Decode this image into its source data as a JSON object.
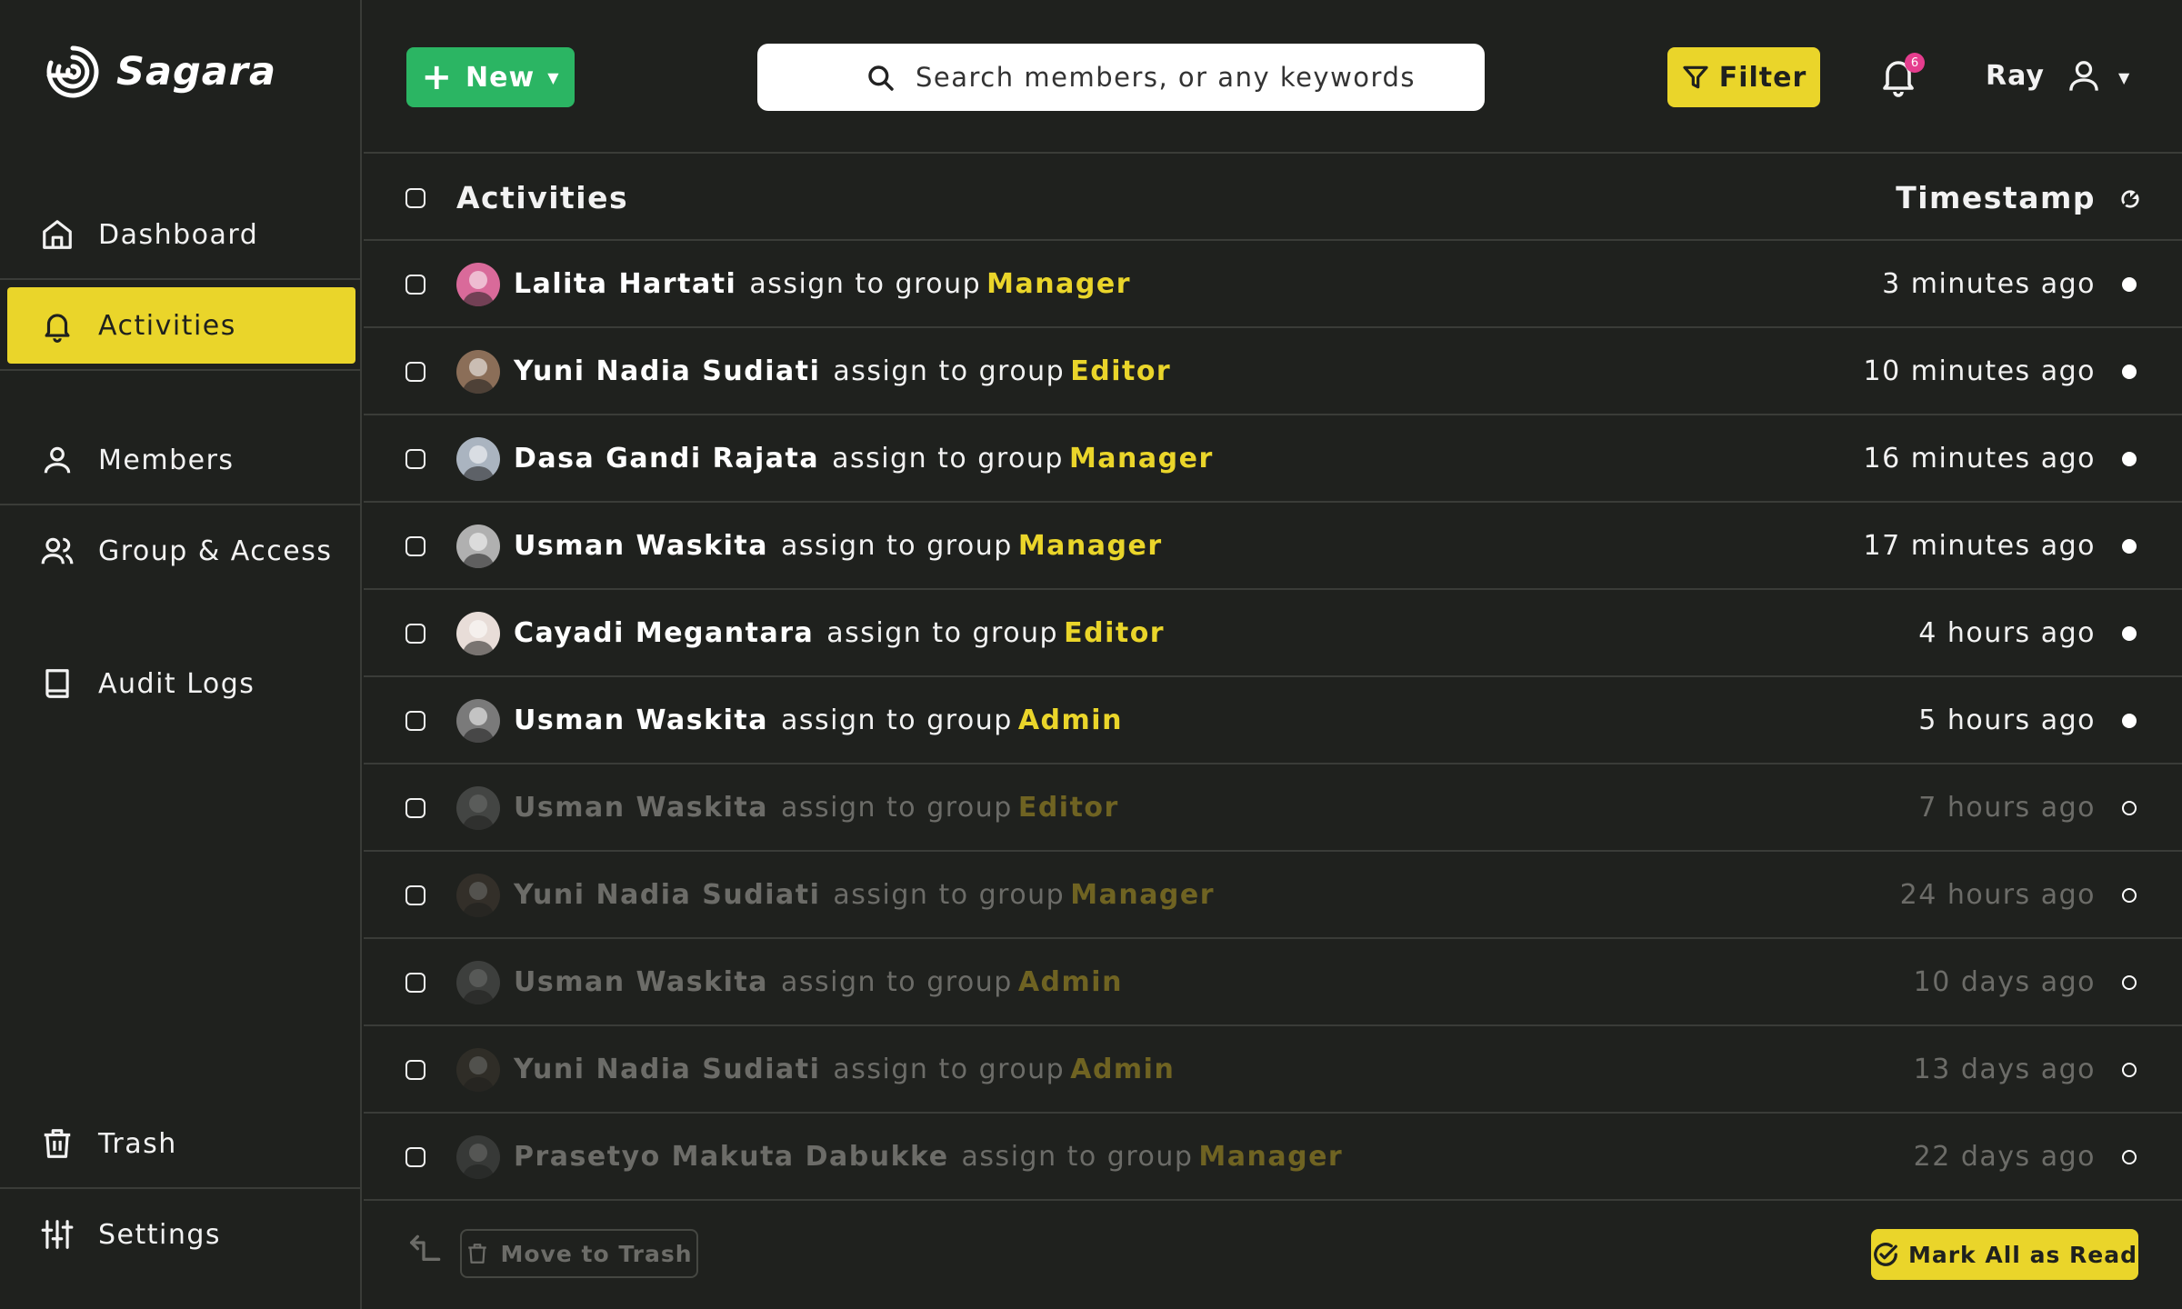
{
  "brand": {
    "name": "Sagara"
  },
  "sidebar": {
    "items": [
      {
        "id": "dashboard",
        "label": "Dashboard",
        "icon": "home-icon"
      },
      {
        "id": "activities",
        "label": "Activities",
        "icon": "bell-icon",
        "active": true
      },
      {
        "id": "members",
        "label": "Members",
        "icon": "user-icon"
      },
      {
        "id": "group-access",
        "label": "Group & Access",
        "icon": "users-icon"
      },
      {
        "id": "audit-logs",
        "label": "Audit Logs",
        "icon": "book-icon"
      },
      {
        "id": "trash",
        "label": "Trash",
        "icon": "trash-icon"
      },
      {
        "id": "settings",
        "label": "Settings",
        "icon": "sliders-icon"
      }
    ]
  },
  "toolbar": {
    "new_label": "New",
    "search_placeholder": "Search members, or any keywords",
    "filter_label": "Filter",
    "notification_count": "6",
    "user_name": "Ray"
  },
  "table": {
    "header": {
      "title": "Activities",
      "timestamp": "Timestamp"
    },
    "rows": [
      {
        "name": "Lalita Hartati",
        "action": "assign to group",
        "group": "Manager",
        "time": "3 minutes ago",
        "read": false
      },
      {
        "name": "Yuni Nadia Sudiati",
        "action": "assign to group",
        "group": "Editor",
        "time": "10 minutes ago",
        "read": false
      },
      {
        "name": "Dasa Gandi Rajata",
        "action": "assign to group",
        "group": "Manager",
        "time": "16 minutes ago",
        "read": false
      },
      {
        "name": "Usman Waskita",
        "action": "assign to group",
        "group": "Manager",
        "time": "17 minutes ago",
        "read": false
      },
      {
        "name": "Cayadi Megantara",
        "action": "assign to group",
        "group": "Editor",
        "time": "4 hours ago",
        "read": false
      },
      {
        "name": "Usman Waskita",
        "action": "assign to group",
        "group": "Admin",
        "time": "5 hours ago",
        "read": false
      },
      {
        "name": "Usman Waskita",
        "action": "assign to group",
        "group": "Editor",
        "time": "7 hours ago",
        "read": true
      },
      {
        "name": "Yuni Nadia Sudiati",
        "action": "assign to group",
        "group": "Manager",
        "time": "24 hours ago",
        "read": true
      },
      {
        "name": "Usman Waskita",
        "action": "assign to group",
        "group": "Admin",
        "time": "10 days ago",
        "read": true
      },
      {
        "name": "Yuni Nadia Sudiati",
        "action": "assign to group",
        "group": "Admin",
        "time": "13 days ago",
        "read": true
      },
      {
        "name": "Prasetyo Makuta Dabukke",
        "action": "assign to group",
        "group": "Manager",
        "time": "22 days ago",
        "read": true
      }
    ]
  },
  "footer": {
    "move_to_trash_label": "Move to Trash",
    "mark_all_read_label": "Mark All as Read"
  },
  "colors": {
    "background": "#1f211e",
    "accent_yellow": "#ead52a",
    "new_green": "#2bb563",
    "badge_pink": "#e53d8e"
  }
}
